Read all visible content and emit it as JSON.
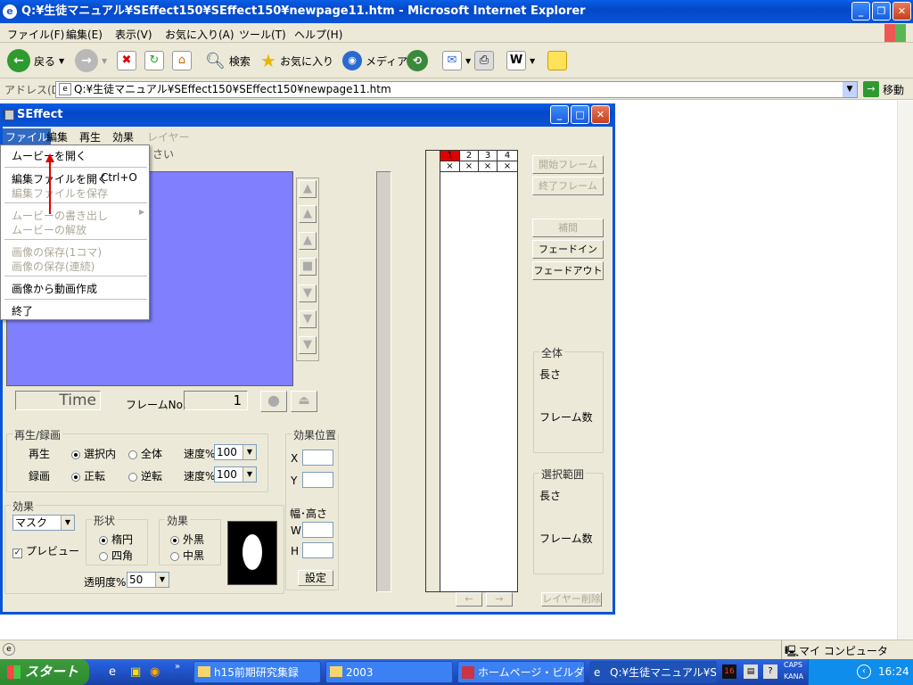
{
  "ie": {
    "title": "Q:¥生徒マニュアル¥SEffect150¥SEffect150¥newpage11.htm - Microsoft Internet Explorer",
    "menu": [
      "ファイル(F)",
      "編集(E)",
      "表示(V)",
      "お気に入り(A)",
      "ツール(T)",
      "ヘルプ(H)"
    ],
    "toolbar": {
      "back": "戻る",
      "search": "検索",
      "favorites": "お気に入り",
      "media": "メディア"
    },
    "address_label": "アドレス(D)",
    "address": "Q:¥生徒マニュアル¥SEffect150¥SEffect150¥newpage11.htm",
    "go": "移動",
    "status_zone": "マイ コンピュータ"
  },
  "seffect": {
    "title": "SEffect",
    "menu": [
      "ファイル",
      "編集",
      "再生",
      "効果",
      "レイヤー"
    ],
    "file_menu": {
      "open_movie": "ムービーを開く",
      "open_edit": "編集ファイルを開く",
      "open_edit_shortcut": "Ctrl+O",
      "save_edit": "編集ファイルを保存",
      "export_movie": "ムービーの書き出し",
      "release_movie": "ムービーの解放",
      "save_image_one": "画像の保存(1コマ)",
      "save_image_cont": "画像の保存(連続)",
      "make_movie": "画像から動画作成",
      "exit": "終了"
    },
    "hidden_text_fragment": "さい",
    "time_label": "Time",
    "frame_no_label": "フレームNo.",
    "frame_no_value": "1",
    "playback": {
      "group": "再生/録画",
      "play_label": "再生",
      "play_opt1": "選択内",
      "play_opt2": "全体",
      "rec_label": "録画",
      "rec_opt1": "正転",
      "rec_opt2": "逆転",
      "speed_label": "速度%",
      "speed1": "100",
      "speed2": "100"
    },
    "effect": {
      "group": "効果",
      "type": "マスク",
      "preview": "プレビュー",
      "shape_group": "形状",
      "shape1": "楕円",
      "shape2": "四角",
      "effect_group": "効果",
      "eff1": "外黒",
      "eff2": "中黒",
      "opacity_label": "透明度%",
      "opacity": "50"
    },
    "position": {
      "group": "効果位置",
      "x": "X",
      "y": "Y",
      "wh": "幅･高さ",
      "w": "W",
      "h": "H",
      "set": "設定"
    },
    "layers": {
      "cols": [
        "1",
        "2",
        "3",
        "4"
      ],
      "marks": [
        "×",
        "×",
        "×",
        "×"
      ],
      "left": "←",
      "right": "→",
      "delete": "レイヤー削除"
    },
    "buttons": {
      "start": "開始フレーム",
      "end": "終了フレーム",
      "interp": "補間",
      "fadein": "フェードイン",
      "fadeout": "フェードアウト"
    },
    "total": {
      "group": "全体",
      "length": "長さ",
      "frames": "フレーム数"
    },
    "selection": {
      "group": "選択範囲",
      "length": "長さ",
      "frames": "フレーム数"
    }
  },
  "taskbar": {
    "start": "スタート",
    "tasks": [
      "h15前期研究集録",
      "2003",
      "ホームページ・ビルダ...",
      "Q:¥生徒マニュアル¥S..."
    ],
    "tray_num": "16",
    "caps": "CAPS",
    "kana": "KANA",
    "time": "16:24"
  },
  "colors": {
    "preview_bg": "#8080ff",
    "accent_arrow": "#e00000",
    "layer_sel": "#e00000"
  }
}
